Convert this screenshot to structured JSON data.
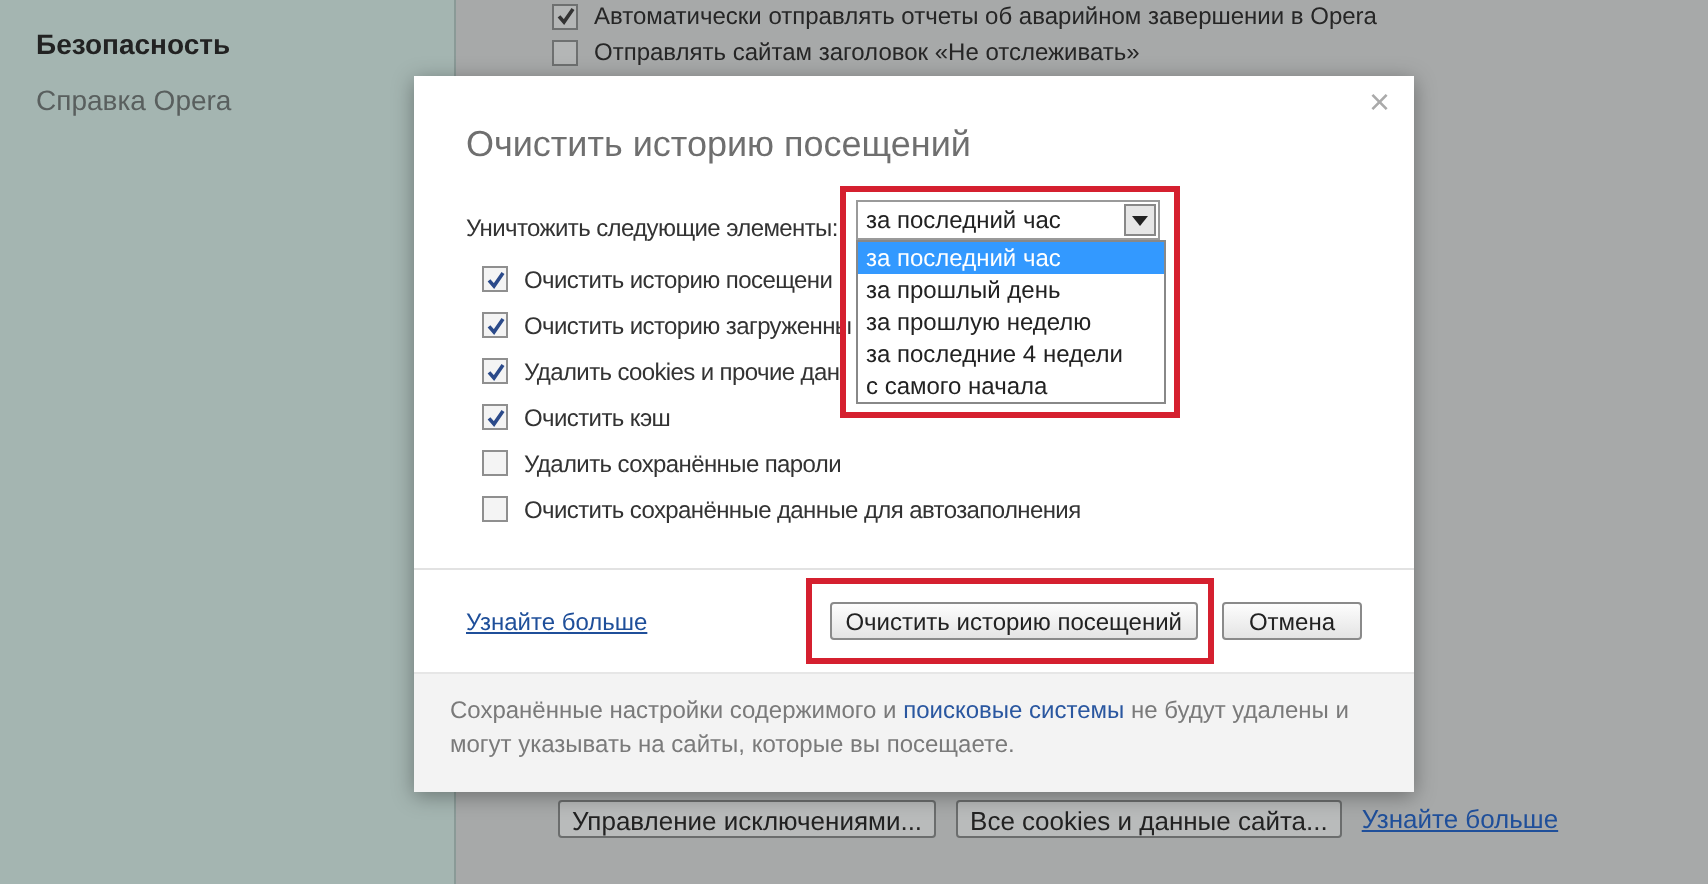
{
  "sidebar": {
    "items": [
      {
        "label": "Безопасность",
        "selected": true
      },
      {
        "label": "Справка Opera",
        "selected": false
      }
    ]
  },
  "background": {
    "options": [
      {
        "label": "Автоматически отправлять отчеты об аварийном завершении в Opera",
        "checked": true
      },
      {
        "label": "Отправлять сайтам заголовок «Не отслеживать»",
        "checked": false
      }
    ],
    "buttons": [
      "Управление исключениями...",
      "Все cookies и данные сайта..."
    ],
    "link": "Узнайте больше"
  },
  "dialog": {
    "title": "Очистить историю посещений",
    "close": "×",
    "range_label": "Уничтожить следующие элементы:",
    "range_value": "за последний час",
    "range_options": [
      {
        "label": "за последний час",
        "selected": true
      },
      {
        "label": "за прошлый день",
        "selected": false
      },
      {
        "label": "за прошлую неделю",
        "selected": false
      },
      {
        "label": "за последние 4 недели",
        "selected": false
      },
      {
        "label": "с самого начала",
        "selected": false
      }
    ],
    "items": [
      {
        "label": "Очистить историю посещени",
        "checked": true
      },
      {
        "label": "Очистить историю загруженны",
        "checked": true
      },
      {
        "label": "Удалить cookies и прочие дан",
        "checked": true
      },
      {
        "label": "Очистить кэш",
        "checked": true
      },
      {
        "label": "Удалить сохранённые пароли",
        "checked": false
      },
      {
        "label": "Очистить сохранённые данные для автозаполнения",
        "checked": false
      }
    ],
    "learn_more": "Узнайте больше",
    "confirm": "Очистить историю посещений",
    "cancel": "Отмена",
    "note": {
      "before": "Сохранённые настройки содержимого и ",
      "link": "поисковые системы",
      "after": " не будут удалены и могут указывать на сайты, которые вы посещаете."
    }
  }
}
